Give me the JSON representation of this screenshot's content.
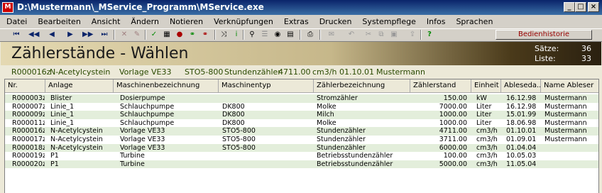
{
  "window": {
    "app_icon": "M",
    "title": "D:\\Mustermann\\_MService_Programm\\MService.exe"
  },
  "menu": [
    "Datei",
    "Bearbeiten",
    "Ansicht",
    "Ändern",
    "Notieren",
    "Verknüpfungen",
    "Extras",
    "Drucken",
    "Systempflege",
    "Infos",
    "Sprachen"
  ],
  "toolbar": {
    "history_label": "Bedienhistorie"
  },
  "header": {
    "heading": "Zählerstände  -  Wählen",
    "saetze_label": "Sätze:",
    "saetze_value": "36",
    "liste_label": "Liste:",
    "liste_value": "33"
  },
  "selection": {
    "nr": "R000016z",
    "anlage": "N-Acetylcystein",
    "maschine": "Vorlage VE33",
    "typ": "STO5-800",
    "zaehler": "Stundenzähler",
    "stand": "4711.00",
    "einheit": "cm3/h",
    "datum": "01.10.01",
    "ableser": "Mustermann"
  },
  "table": {
    "columns": [
      "Nr.",
      "Anlage",
      "Maschinenbezeichnung",
      "Maschinentyp",
      "Zählerbezeichnung",
      "Zählerstand",
      "Einheit",
      "Ablesedа...",
      "Name Ableser"
    ],
    "rows": [
      [
        "R000003z",
        "Blister",
        "Dosierpumpe",
        "",
        "Stromzähler",
        "150.00",
        "kW",
        "16.12.98",
        "Mustermann"
      ],
      [
        "R000007z",
        "Linie_1",
        "Schlauchpumpe",
        "DK800",
        "Molke",
        "7000.00",
        "Liter",
        "16.12.98",
        "Mustermann"
      ],
      [
        "R000009z",
        "Linie_1",
        "Schlauchpumpe",
        "DK800",
        "Milch",
        "1000.00",
        "Liter",
        "15.01.99",
        "Mustermann"
      ],
      [
        "R000011z",
        "Linie_1",
        "Schlauchpumpe",
        "DK800",
        "Molke",
        "1000.00",
        "Liter",
        "18.06.98",
        "Mustermann"
      ],
      [
        "R000016z",
        "N-Acetylcystein",
        "Vorlage VE33",
        "STO5-800",
        "Stundenzähler",
        "4711.00",
        "cm3/h",
        "01.10.01",
        "Mustermann"
      ],
      [
        "R000017z",
        "N-Acetylcystein",
        "Vorlage VE33",
        "STO5-800",
        "Stundenzähler",
        "3711.00",
        "cm3/h",
        "01.09.01",
        "Mustermann"
      ],
      [
        "R000018z",
        "N-Acetylcystein",
        "Vorlage VE33",
        "STO5-800",
        "Stundenzähler",
        "6000.00",
        "cm3/h",
        "01.04.04",
        ""
      ],
      [
        "R000019z",
        "P1",
        "Turbine",
        "",
        "Betriebsstundenzähler",
        "100.00",
        "cm3/h",
        "10.05.03",
        ""
      ],
      [
        "R000020z",
        "P1",
        "Turbine",
        "",
        "Betriebsstundenzähler",
        "5000.00",
        "cm3/h",
        "11.05.04",
        ""
      ]
    ]
  }
}
